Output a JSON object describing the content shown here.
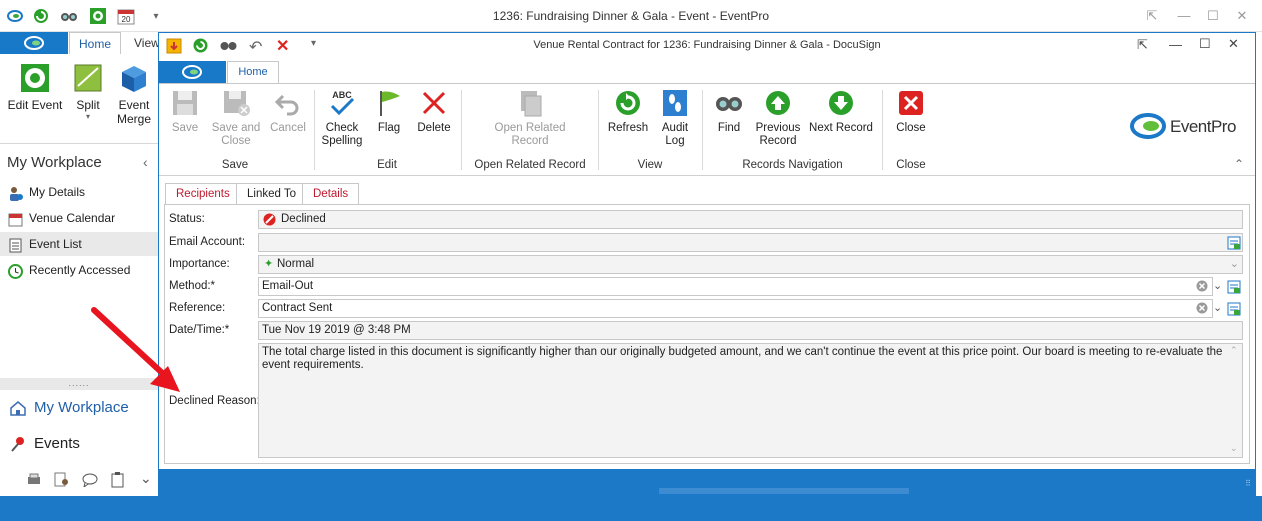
{
  "outer_window": {
    "title": "1236: Fundraising Dinner & Gala - Event - EventPro",
    "controls": {
      "pin": "⇱",
      "minimize": "—",
      "maximize": "☐",
      "close": "✕"
    }
  },
  "left_ribbon": {
    "tabs": {
      "home": "Home",
      "view": "View"
    },
    "buttons": {
      "edit_event": "Edit Event",
      "split": "Split",
      "event_merge_1": "Event",
      "event_merge_2": "Merge"
    }
  },
  "workplace": {
    "title": "My Workplace",
    "collapse": "‹",
    "items": [
      {
        "label": "My Details",
        "icon": "user-info-icon"
      },
      {
        "label": "Venue Calendar",
        "icon": "calendar-icon"
      },
      {
        "label": "Event List",
        "icon": "list-icon"
      },
      {
        "label": "Recently Accessed",
        "icon": "clock-icon"
      }
    ],
    "splitter": "......",
    "big_nav": [
      {
        "label": "My Workplace",
        "icon": "home-icon"
      },
      {
        "label": "Events",
        "icon": "pin-icon"
      }
    ],
    "more": "⌄"
  },
  "inner_window": {
    "title": "Venue Rental Contract for 1236: Fundraising Dinner & Gala - DocuSign",
    "tab_home": "Home",
    "controls": {
      "pin": "⇱",
      "minimize": "—",
      "maximize": "☐",
      "close": "✕"
    }
  },
  "ribbon": {
    "save": "Save",
    "save_close_1": "Save and",
    "save_close_2": "Close",
    "cancel": "Cancel",
    "check_1": "Check",
    "check_2": "Spelling",
    "flag": "Flag",
    "delete": "Delete",
    "open_related_1": "Open Related",
    "open_related_2": "Record",
    "refresh": "Refresh",
    "audit_1": "Audit",
    "audit_2": "Log",
    "find": "Find",
    "prev_1": "Previous",
    "prev_2": "Record",
    "next": "Next Record",
    "close": "Close",
    "groups": {
      "save": "Save",
      "edit": "Edit",
      "open_related": "Open Related Record",
      "view": "View",
      "nav": "Records Navigation",
      "close": "Close"
    },
    "logo": "EventPro",
    "collapse": "⌃"
  },
  "detail_tabs": {
    "recipients": "Recipients",
    "linked_to": "Linked To",
    "details": "Details"
  },
  "details": {
    "status_label": "Status:",
    "status_value": "Declined",
    "email_label": "Email Account:",
    "email_value": "",
    "importance_label": "Importance:",
    "importance_value": "Normal",
    "method_label": "Method:*",
    "method_value": "Email-Out",
    "reference_label": "Reference:",
    "reference_value": "Contract Sent",
    "datetime_label": "Date/Time:*",
    "datetime_value": "Tue Nov 19 2019 @ 3:48 PM",
    "reason_label": "Declined Reason:",
    "reason_value": "The total charge listed in this document is significantly higher than our originally budgeted amount, and we can't continue the event at this price point. Our board is meeting to re-evaluate the event requirements."
  },
  "colors": {
    "accent": "#1c79c8",
    "tab_text": "#c0192d"
  }
}
